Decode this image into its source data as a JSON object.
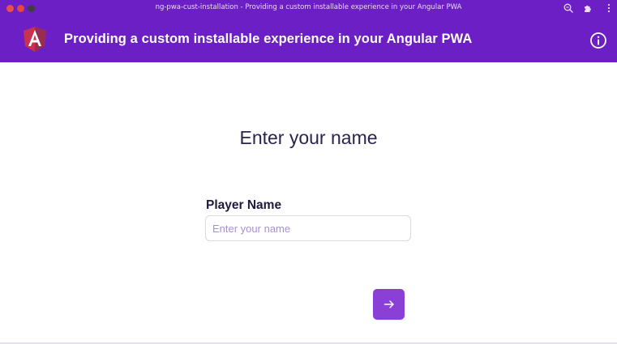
{
  "window": {
    "title": "ng-pwa-cust-installation - Providing a custom installable experience in your Angular PWA",
    "toolbar_icons": [
      "zoom-icon",
      "extensions-icon",
      "more-menu-icon"
    ]
  },
  "header": {
    "title": "Providing a custom installable experience in your Angular PWA",
    "logo_icon": "angular-logo-icon",
    "info_icon": "info-icon"
  },
  "main": {
    "heading": "Enter your name",
    "field_label": "Player Name",
    "input_value": "",
    "input_placeholder": "Enter your name",
    "next_icon": "arrow-right-icon"
  },
  "colors": {
    "brand": "#6b1fc4",
    "button": "#8a3fd6",
    "heading_text": "#2b2350",
    "placeholder_text": "#a88fd2",
    "angular_red": "#dd0031"
  }
}
